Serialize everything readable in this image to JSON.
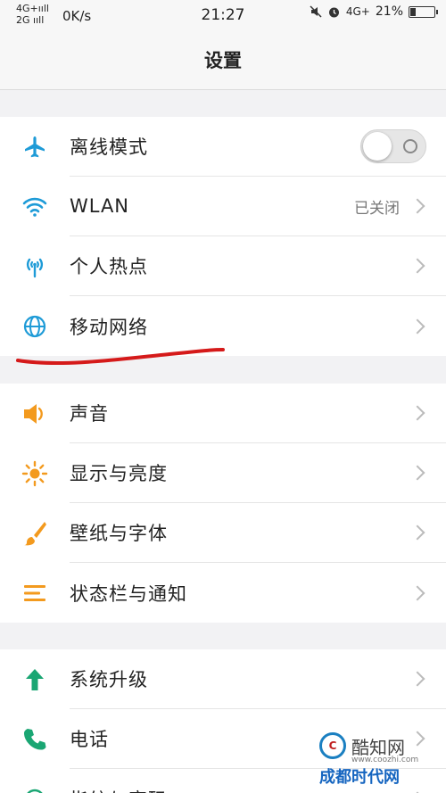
{
  "status_bar": {
    "sim1": "4G+ııll",
    "sim2": "2G ııll",
    "speed": "0K/s",
    "time": "21:27",
    "sim_right": "4G+",
    "battery_percent": "21%",
    "battery_level": 0.21,
    "icons": [
      "mute-icon",
      "alarm-icon"
    ]
  },
  "header": {
    "title": "设置"
  },
  "group1": [
    {
      "label": "离线模式",
      "icon": "airplane-icon",
      "control": "toggle",
      "toggle_on": false
    },
    {
      "label": "WLAN",
      "icon": "wifi-icon",
      "value": "已关闭"
    },
    {
      "label": "个人热点",
      "icon": "hotspot-icon"
    },
    {
      "label": "移动网络",
      "icon": "globe-icon"
    }
  ],
  "group2": [
    {
      "label": "声音",
      "icon": "speaker-icon"
    },
    {
      "label": "显示与亮度",
      "icon": "brightness-icon"
    },
    {
      "label": "壁纸与字体",
      "icon": "brush-icon"
    },
    {
      "label": "状态栏与通知",
      "icon": "notification-icon"
    }
  ],
  "group3": [
    {
      "label": "系统升级",
      "icon": "upgrade-arrow-icon"
    },
    {
      "label": "电话",
      "icon": "phone-icon"
    },
    {
      "label": "指纹与密码",
      "icon": "fingerprint-icon"
    }
  ],
  "colors": {
    "blue_icon": "#1e9bd7",
    "orange_icon": "#f39a1e",
    "green_icon": "#1aa673",
    "annotation_red": "#d51a1a"
  },
  "watermark": {
    "logo_text": "C",
    "name": "酷知网",
    "url": "www.coozhi.com",
    "bottom_text": "成都时代网"
  }
}
